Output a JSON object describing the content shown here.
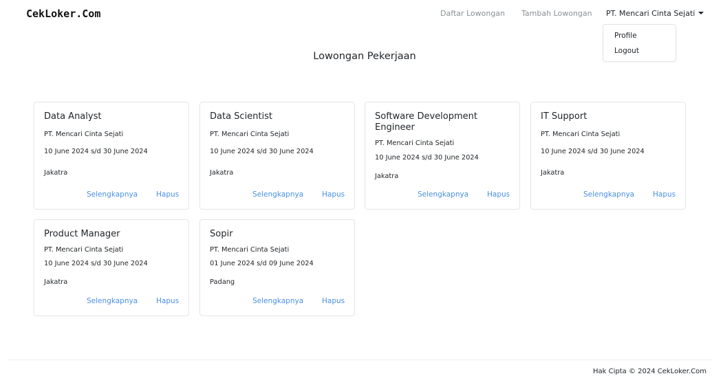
{
  "navbar": {
    "brand": "CekLoker.Com",
    "links": [
      "Daftar Lowongan",
      "Tambah Lowongan"
    ],
    "user": "PT. Mencari Cinta Sejati",
    "dropdown": [
      "Profile",
      "Logout"
    ]
  },
  "page": {
    "title": "Lowongan Pekerjaan"
  },
  "jobs": [
    {
      "title": "Data Analyst",
      "company": "PT. Mencari Cinta Sejati",
      "period": "10 June 2024 s/d 30 June 2024",
      "location": "Jakatra",
      "more_label": "Selengkapnya",
      "delete_label": "Hapus"
    },
    {
      "title": "Data Scientist",
      "company": "PT. Mencari Cinta Sejati",
      "period": "10 June 2024 s/d 30 June 2024",
      "location": "Jakatra",
      "more_label": "Selengkapnya",
      "delete_label": "Hapus"
    },
    {
      "title": "Software Development Engineer",
      "company": "PT. Mencari Cinta Sejati",
      "period": "10 June 2024 s/d 30 June 2024",
      "location": "Jakatra",
      "more_label": "Selengkapnya",
      "delete_label": "Hapus"
    },
    {
      "title": "IT Support",
      "company": "PT. Mencari Cinta Sejati",
      "period": "10 June 2024 s/d 30 June 2024",
      "location": "Jakatra",
      "more_label": "Selengkapnya",
      "delete_label": "Hapus"
    },
    {
      "title": "Product Manager",
      "company": "PT. Mencari Cinta Sejati",
      "period": "10 June 2024 s/d 30 June 2024",
      "location": "Jakatra",
      "more_label": "Selengkapnya",
      "delete_label": "Hapus"
    },
    {
      "title": "Sopir",
      "company": "PT. Mencari Cinta Sejati",
      "period": "01 June 2024 s/d 09 June 2024",
      "location": "Padang",
      "more_label": "Selengkapnya",
      "delete_label": "Hapus"
    }
  ],
  "footer": {
    "text": "Hak Cipta © 2024 CekLoker.Com"
  },
  "colors": {
    "link": "#4a90e2",
    "nav_muted": "#8a8f94",
    "text": "#212529",
    "border": "#e5e5e5"
  }
}
